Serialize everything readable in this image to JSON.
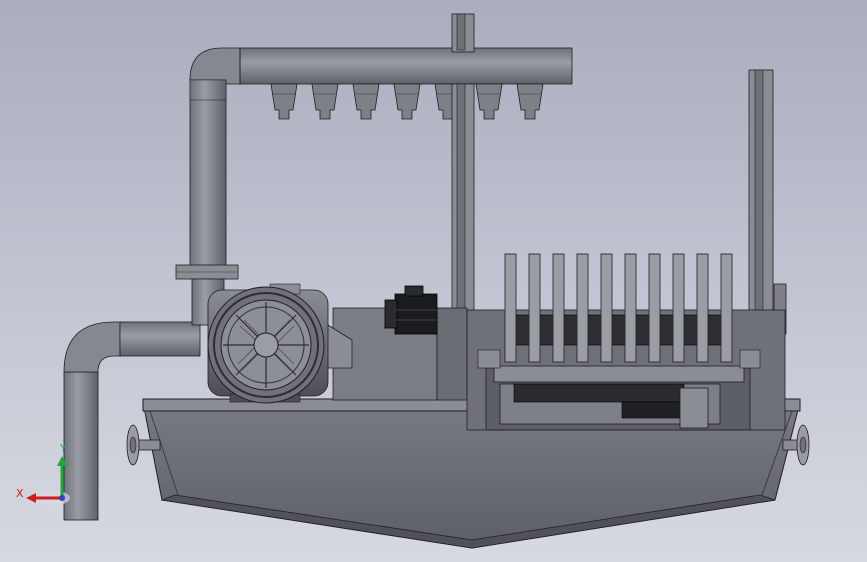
{
  "view": {
    "name": "cad-model-viewport",
    "colors": {
      "background_top": "#a9adbd",
      "background_bottom": "#d7d9e0",
      "part_body": "#6e7178",
      "part_light": "#8d9097",
      "part_dark": "#3a3c40",
      "edge": "#1e1f22"
    }
  },
  "triad": {
    "x_label": "X",
    "y_label": "Y",
    "x_color": "#d01c1c",
    "y_color": "#1fa83a",
    "z_color": "#2f3fc8"
  }
}
